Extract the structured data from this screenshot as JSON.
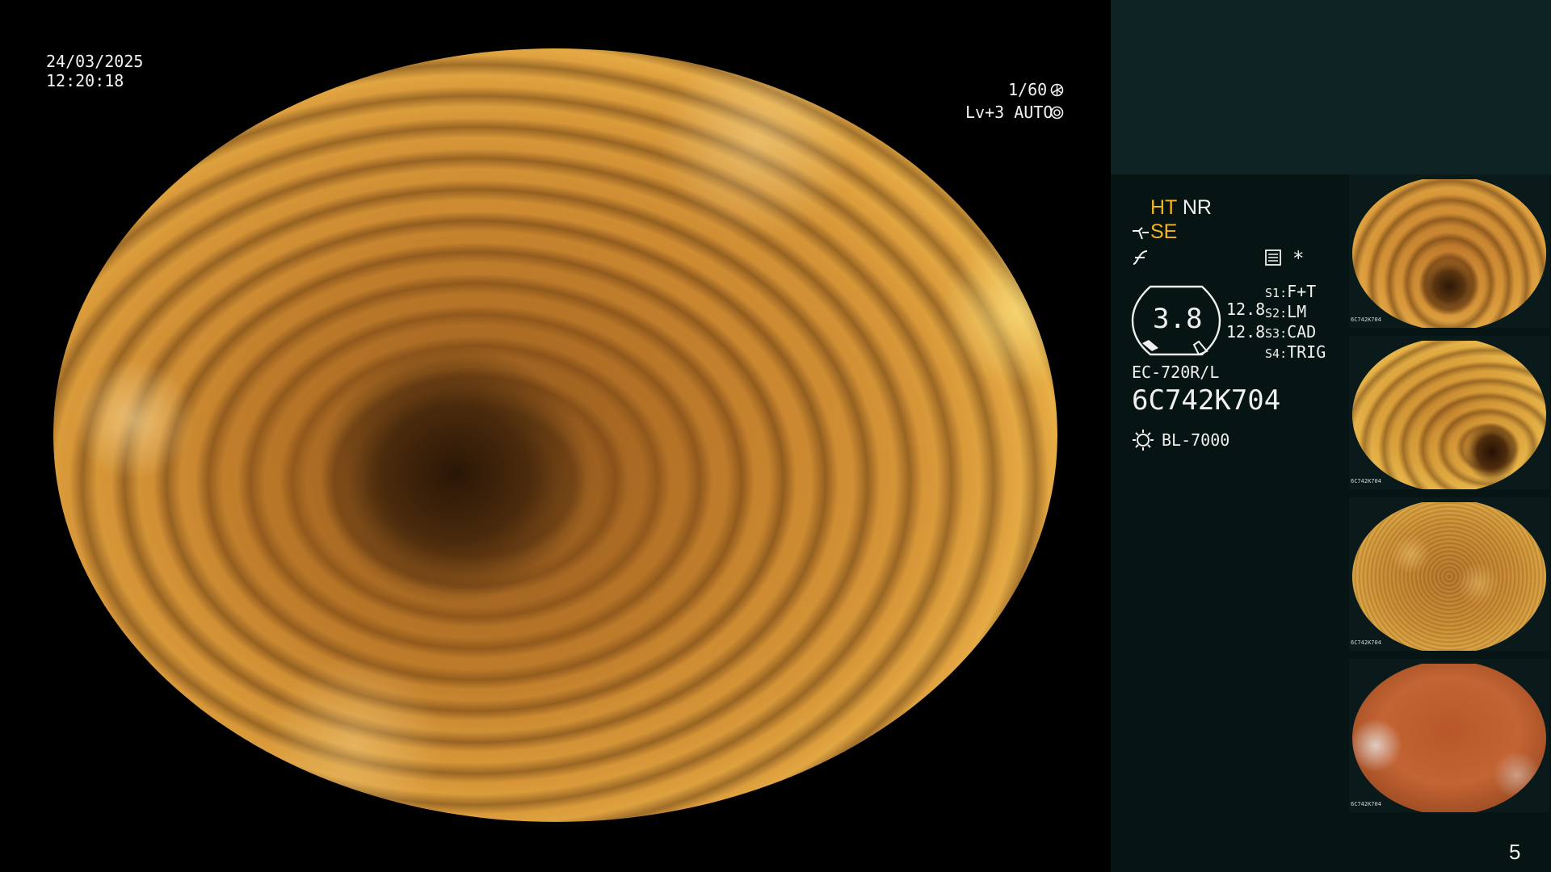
{
  "overlay": {
    "date": "24/03/2025",
    "time": "12:20:18",
    "shutter": "1/60",
    "level": "Lv+3 AUTO"
  },
  "panel": {
    "ht": "HT",
    "nr": "NR",
    "se": "SE",
    "zoom_value": "3.8",
    "readout_1": "12.8",
    "readout_2": "12.8",
    "switches": [
      {
        "key": "S1",
        "value": "F+T"
      },
      {
        "key": "S2",
        "value": "LM"
      },
      {
        "key": "S3",
        "value": "CAD"
      },
      {
        "key": "S4",
        "value": "TRIG"
      }
    ],
    "scope_model": "EC-720R/L",
    "scope_serial": "6C742K704",
    "light_source": "BL-7000",
    "asterisk": "*",
    "page_number": "5"
  },
  "thumbnails": [
    {
      "id": "4",
      "caption": "6C742K704",
      "source": "BL-7000"
    },
    {
      "id": "3",
      "caption": "6C742K704",
      "source": "BL-7000"
    },
    {
      "id": "2",
      "caption": "6C742K704",
      "source": "BL-7000"
    },
    {
      "id": "1",
      "caption": "6C742K704",
      "source": "BL-7000"
    }
  ],
  "colors": {
    "accent": "#f2b51c",
    "panel_top": "#0e2424",
    "panel_body": "#061414"
  },
  "icons": [
    "shutter-icon",
    "auto-iris-icon",
    "settings-icon",
    "enhance-icon",
    "curve-icon",
    "light-source-icon"
  ]
}
